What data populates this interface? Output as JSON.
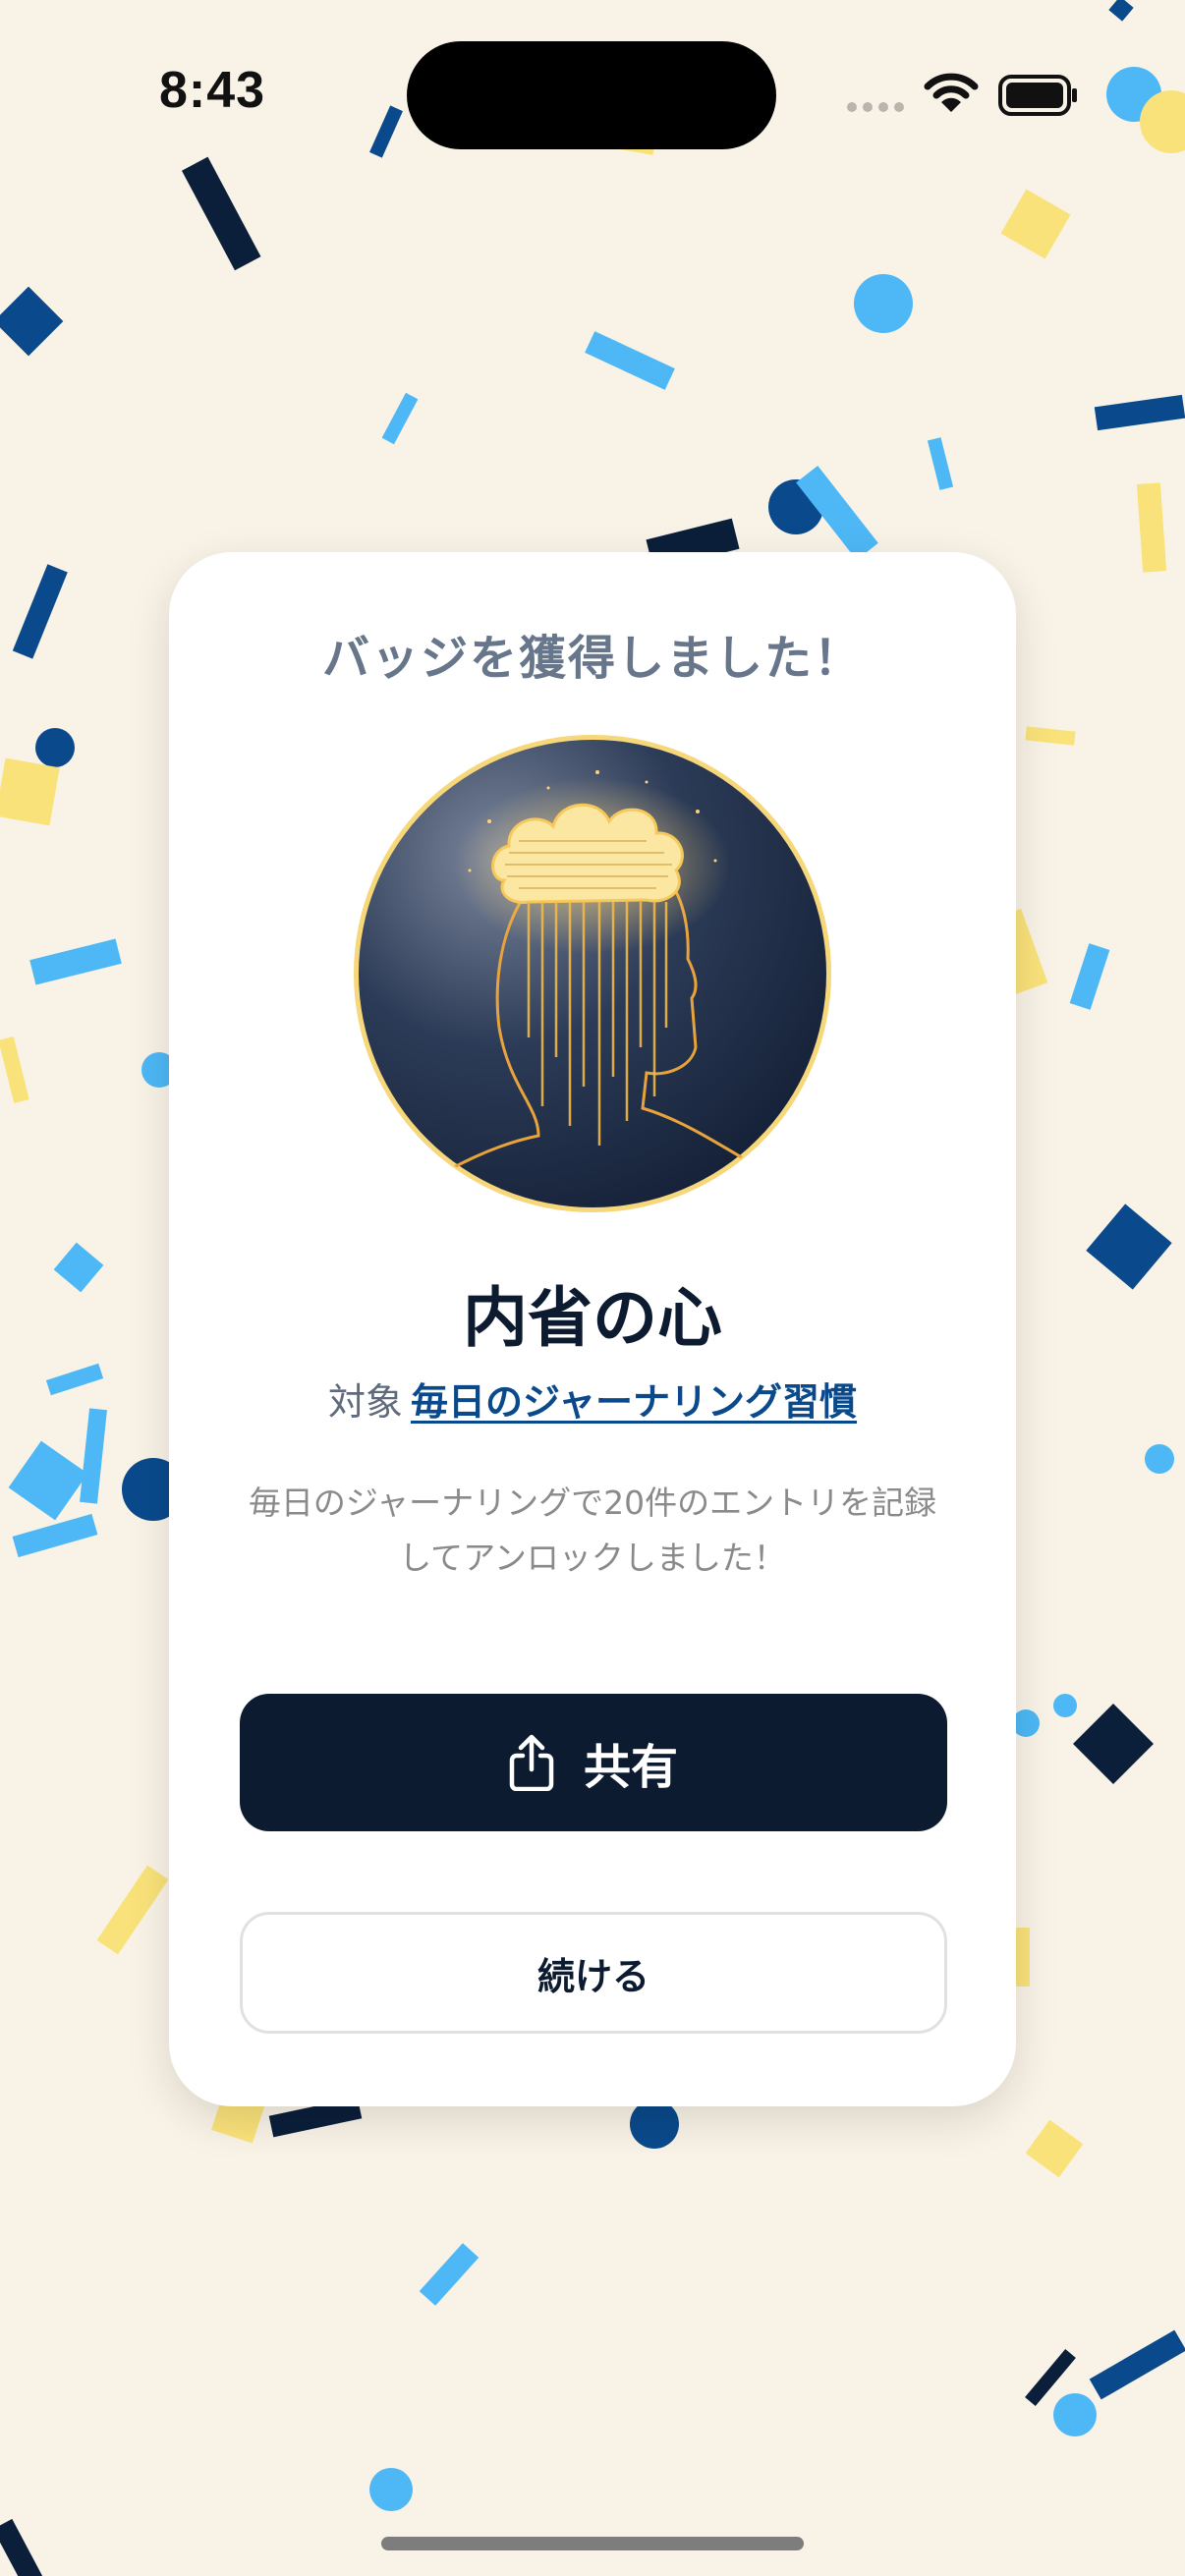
{
  "status_bar": {
    "time": "8:43"
  },
  "card": {
    "heading": "バッジを獲得しました！",
    "badge_title": "内省の心",
    "target_prefix": "対象",
    "target_link": "毎日のジャーナリング習慣",
    "description": "毎日のジャーナリングで20件のエントリを記録してアンロックしました！",
    "share_label": "共有",
    "continue_label": "続ける"
  },
  "icons": {
    "share": "share-icon",
    "wifi": "wifi-icon",
    "battery": "battery-icon",
    "signal": "signal-icon"
  },
  "colors": {
    "background": "#f9f3e7",
    "primary_dark": "#0d1b31",
    "link": "#0a4a8c",
    "badge_ring": "#f6d77a",
    "confetti_navy": "#0b1f3a",
    "confetti_blue": "#0a4a8c",
    "confetti_sky": "#4db8f5",
    "confetti_yellow": "#fae27a"
  }
}
